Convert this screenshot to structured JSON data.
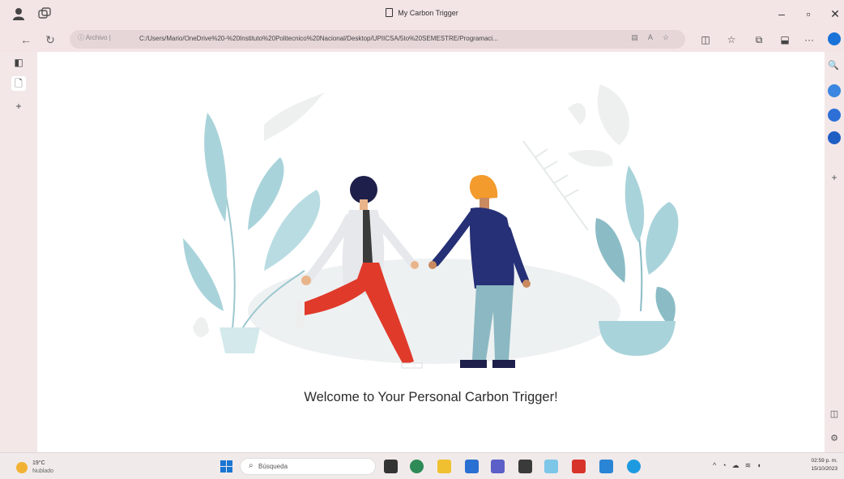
{
  "window": {
    "title": "My Carbon Trigger"
  },
  "address_bar": {
    "info_label": "Archivo",
    "url": "C:/Users/Mario/OneDrive%20-%20Instituto%20Politecnico%20Nacional/Desktop/UPIICSA/5to%20SEMESTRE/Programaci..."
  },
  "page": {
    "welcome_text": "Welcome to Your Personal Carbon Trigger!"
  },
  "taskbar": {
    "weather_temp": "19°C",
    "weather_desc": "Nublado",
    "search_placeholder": "Búsqueda",
    "time": "02:59 p. m.",
    "date": "15/10/2023"
  },
  "colors": {
    "leaf": "#a9d3da",
    "leaf_dark": "#8bbcc6",
    "accent_red": "#e03a2b",
    "navy": "#253076",
    "skin": "#e9b48a"
  }
}
